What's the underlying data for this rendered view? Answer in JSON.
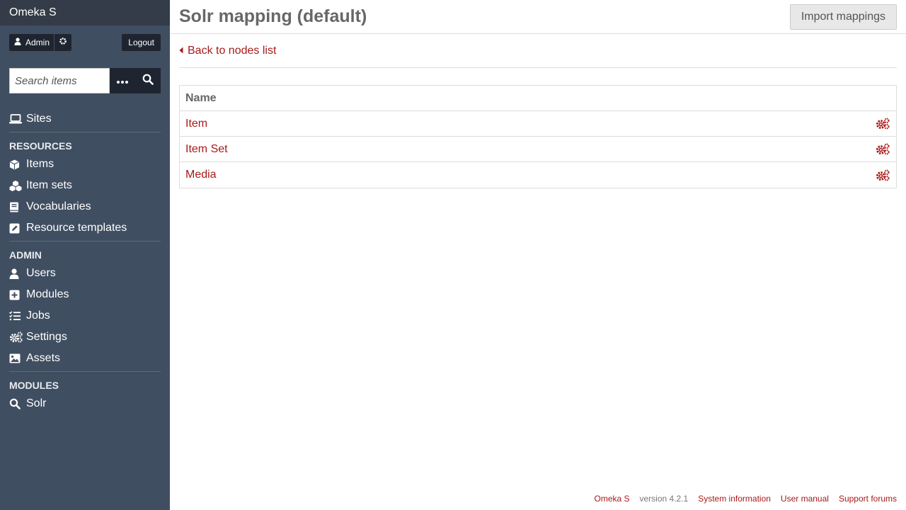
{
  "app": {
    "title": "Omeka S"
  },
  "user": {
    "name": "Admin",
    "logout_label": "Logout"
  },
  "search": {
    "placeholder": "Search items"
  },
  "nav": {
    "sites_label": "Sites",
    "resources_heading": "Resources",
    "resources": [
      {
        "label": "Items",
        "icon": "cube-icon"
      },
      {
        "label": "Item sets",
        "icon": "cubes-icon"
      },
      {
        "label": "Vocabularies",
        "icon": "book-icon"
      },
      {
        "label": "Resource templates",
        "icon": "edit-icon"
      }
    ],
    "admin_heading": "Admin",
    "admin": [
      {
        "label": "Users",
        "icon": "user-icon"
      },
      {
        "label": "Modules",
        "icon": "plus-square-icon"
      },
      {
        "label": "Jobs",
        "icon": "tasks-icon"
      },
      {
        "label": "Settings",
        "icon": "cogs-icon"
      },
      {
        "label": "Assets",
        "icon": "image-icon"
      }
    ],
    "modules_heading": "Modules",
    "modules": [
      {
        "label": "Solr",
        "icon": "search-icon"
      }
    ]
  },
  "header": {
    "title": "Solr mapping (default)",
    "import_label": "Import mappings"
  },
  "back_link": "Back to nodes list",
  "table": {
    "column_name": "Name",
    "rows": [
      {
        "name": "Item"
      },
      {
        "name": "Item Set"
      },
      {
        "name": "Media"
      }
    ]
  },
  "footer": {
    "brand": "Omeka S",
    "version": "version 4.2.1",
    "system_info": "System information",
    "user_manual": "User manual",
    "support": "Support forums"
  },
  "colors": {
    "sidebar_bg": "#404e61",
    "sidebar_top_bg": "#333c48",
    "link": "#a91919"
  }
}
